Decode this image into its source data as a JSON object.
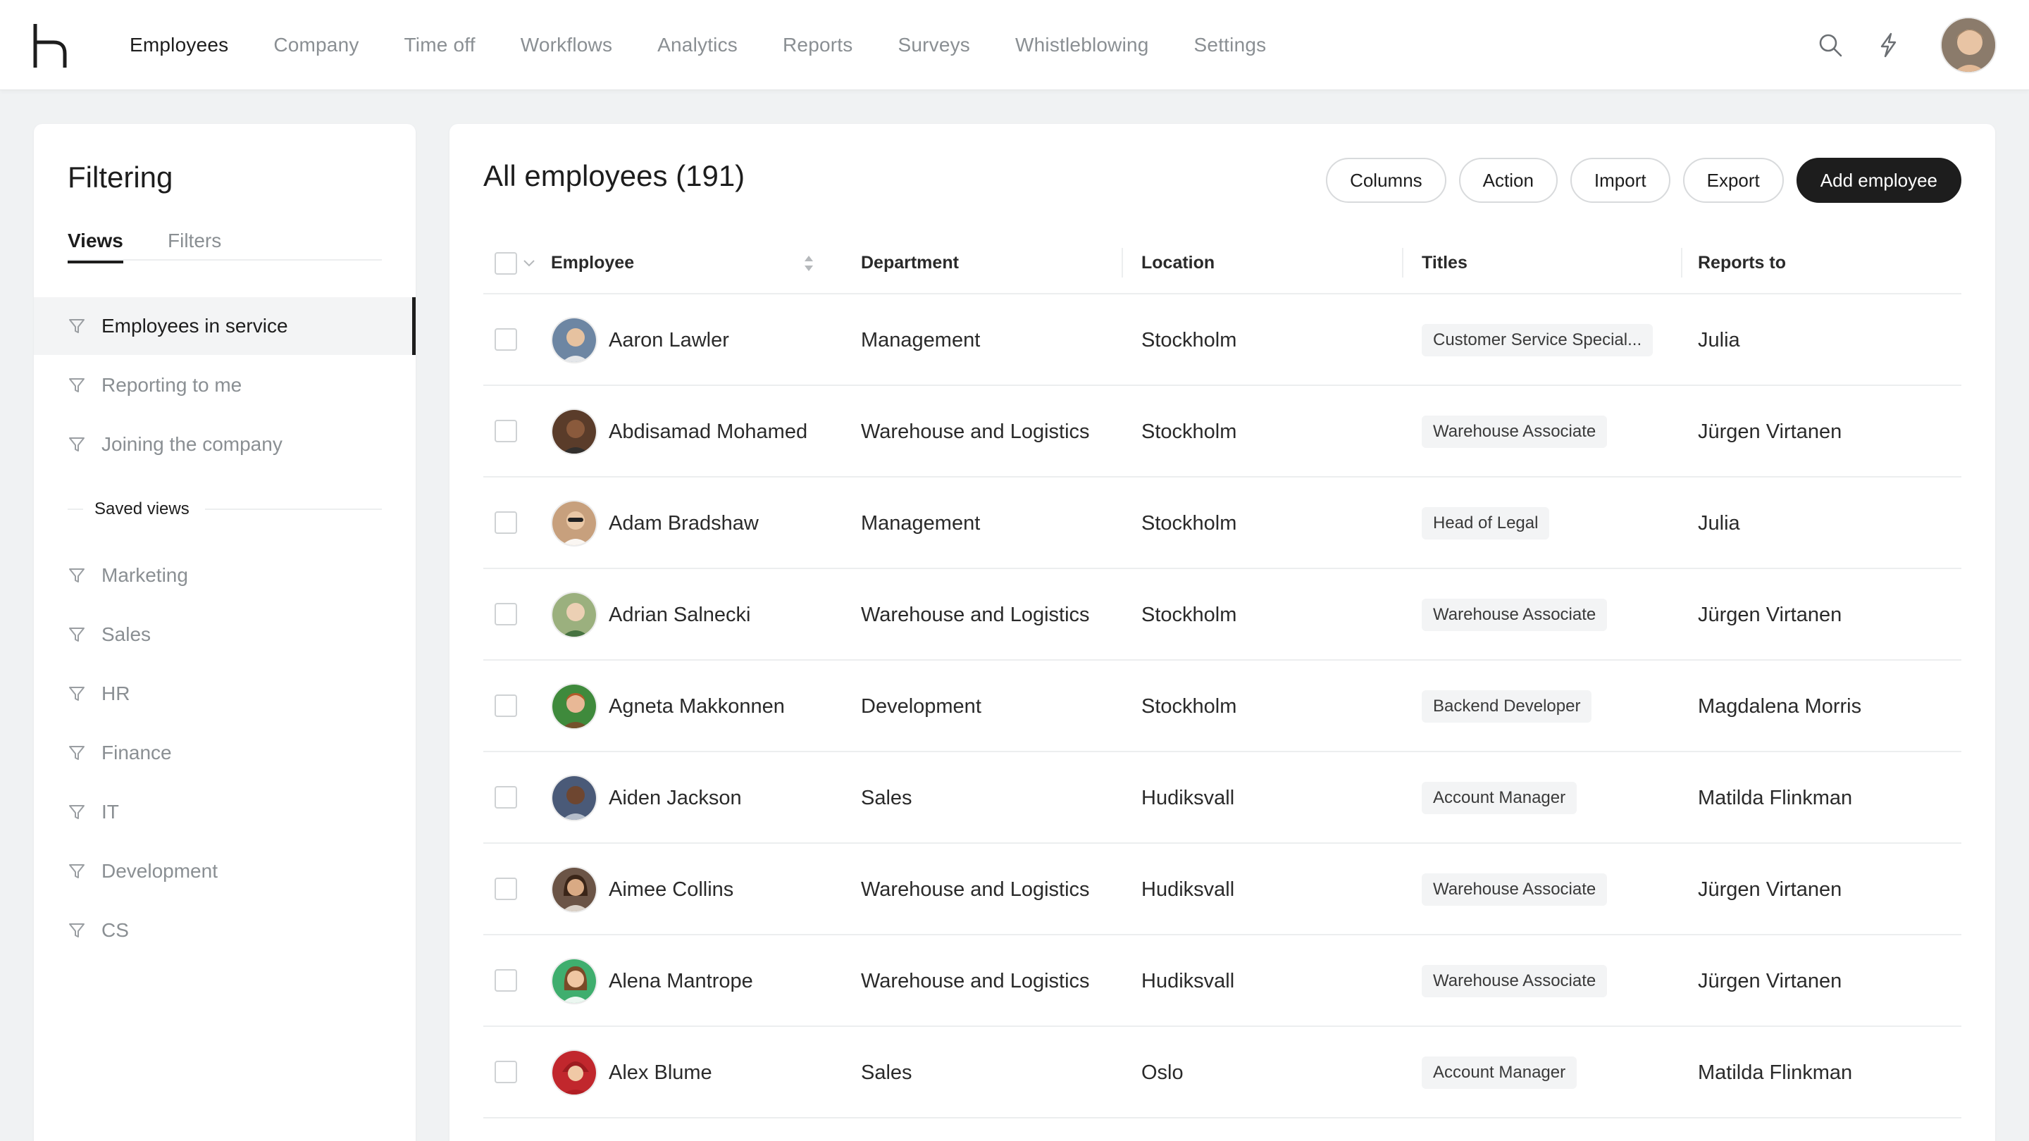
{
  "nav": {
    "items": [
      {
        "label": "Employees",
        "active": true
      },
      {
        "label": "Company",
        "active": false
      },
      {
        "label": "Time off",
        "active": false
      },
      {
        "label": "Workflows",
        "active": false
      },
      {
        "label": "Analytics",
        "active": false
      },
      {
        "label": "Reports",
        "active": false
      },
      {
        "label": "Surveys",
        "active": false
      },
      {
        "label": "Whistleblowing",
        "active": false
      },
      {
        "label": "Settings",
        "active": false
      }
    ],
    "icons": [
      "search-icon",
      "lightning-icon",
      "avatar"
    ]
  },
  "filtering": {
    "title": "Filtering",
    "tabs": {
      "views": "Views",
      "filters": "Filters"
    },
    "views": [
      {
        "label": "Employees in service",
        "active": true
      },
      {
        "label": "Reporting to me",
        "active": false
      },
      {
        "label": "Joining the company",
        "active": false
      }
    ],
    "saved_views_label": "Saved views",
    "saved_views": [
      {
        "label": "Marketing"
      },
      {
        "label": "Sales"
      },
      {
        "label": "HR"
      },
      {
        "label": "Finance"
      },
      {
        "label": "IT"
      },
      {
        "label": "Development"
      },
      {
        "label": "CS"
      }
    ]
  },
  "main": {
    "title": "All employees (191)",
    "buttons": {
      "columns": "Columns",
      "action": "Action",
      "import": "Import",
      "export": "Export",
      "add": "Add employee"
    },
    "columns": {
      "employee": "Employee",
      "department": "Department",
      "location": "Location",
      "titles": "Titles",
      "reports_to": "Reports to"
    },
    "rows": [
      {
        "name": "Aaron Lawler",
        "department": "Management",
        "location": "Stockholm",
        "title": "Customer Service Special...",
        "reports_to": "Julia",
        "avatar_color": "#6d86a3"
      },
      {
        "name": "Abdisamad Mohamed",
        "department": "Warehouse and Logistics",
        "location": "Stockholm",
        "title": "Warehouse Associate",
        "reports_to": "Jürgen Virtanen",
        "avatar_color": "#5a3c2a"
      },
      {
        "name": "Adam Bradshaw",
        "department": "Management",
        "location": "Stockholm",
        "title": "Head of Legal",
        "reports_to": "Julia",
        "avatar_color": "#c7a07d"
      },
      {
        "name": "Adrian Salnecki",
        "department": "Warehouse and Logistics",
        "location": "Stockholm",
        "title": "Warehouse Associate",
        "reports_to": "Jürgen Virtanen",
        "avatar_color": "#9bb07e"
      },
      {
        "name": "Agneta Makkonnen",
        "department": "Development",
        "location": "Stockholm",
        "title": "Backend Developer",
        "reports_to": "Magdalena Morris",
        "avatar_color": "#3f8a3c"
      },
      {
        "name": "Aiden Jackson",
        "department": "Sales",
        "location": "Hudiksvall",
        "title": "Account Manager",
        "reports_to": "Matilda Flinkman",
        "avatar_color": "#4a5a78"
      },
      {
        "name": "Aimee Collins",
        "department": "Warehouse and Logistics",
        "location": "Hudiksvall",
        "title": "Warehouse Associate",
        "reports_to": "Jürgen Virtanen",
        "avatar_color": "#6b5446"
      },
      {
        "name": "Alena Mantrope",
        "department": "Warehouse and Logistics",
        "location": "Hudiksvall",
        "title": "Warehouse Associate",
        "reports_to": "Jürgen Virtanen",
        "avatar_color": "#3fae6e"
      },
      {
        "name": "Alex Blume",
        "department": "Sales",
        "location": "Oslo",
        "title": "Account Manager",
        "reports_to": "Matilda Flinkman",
        "avatar_color": "#c1272d"
      }
    ]
  }
}
